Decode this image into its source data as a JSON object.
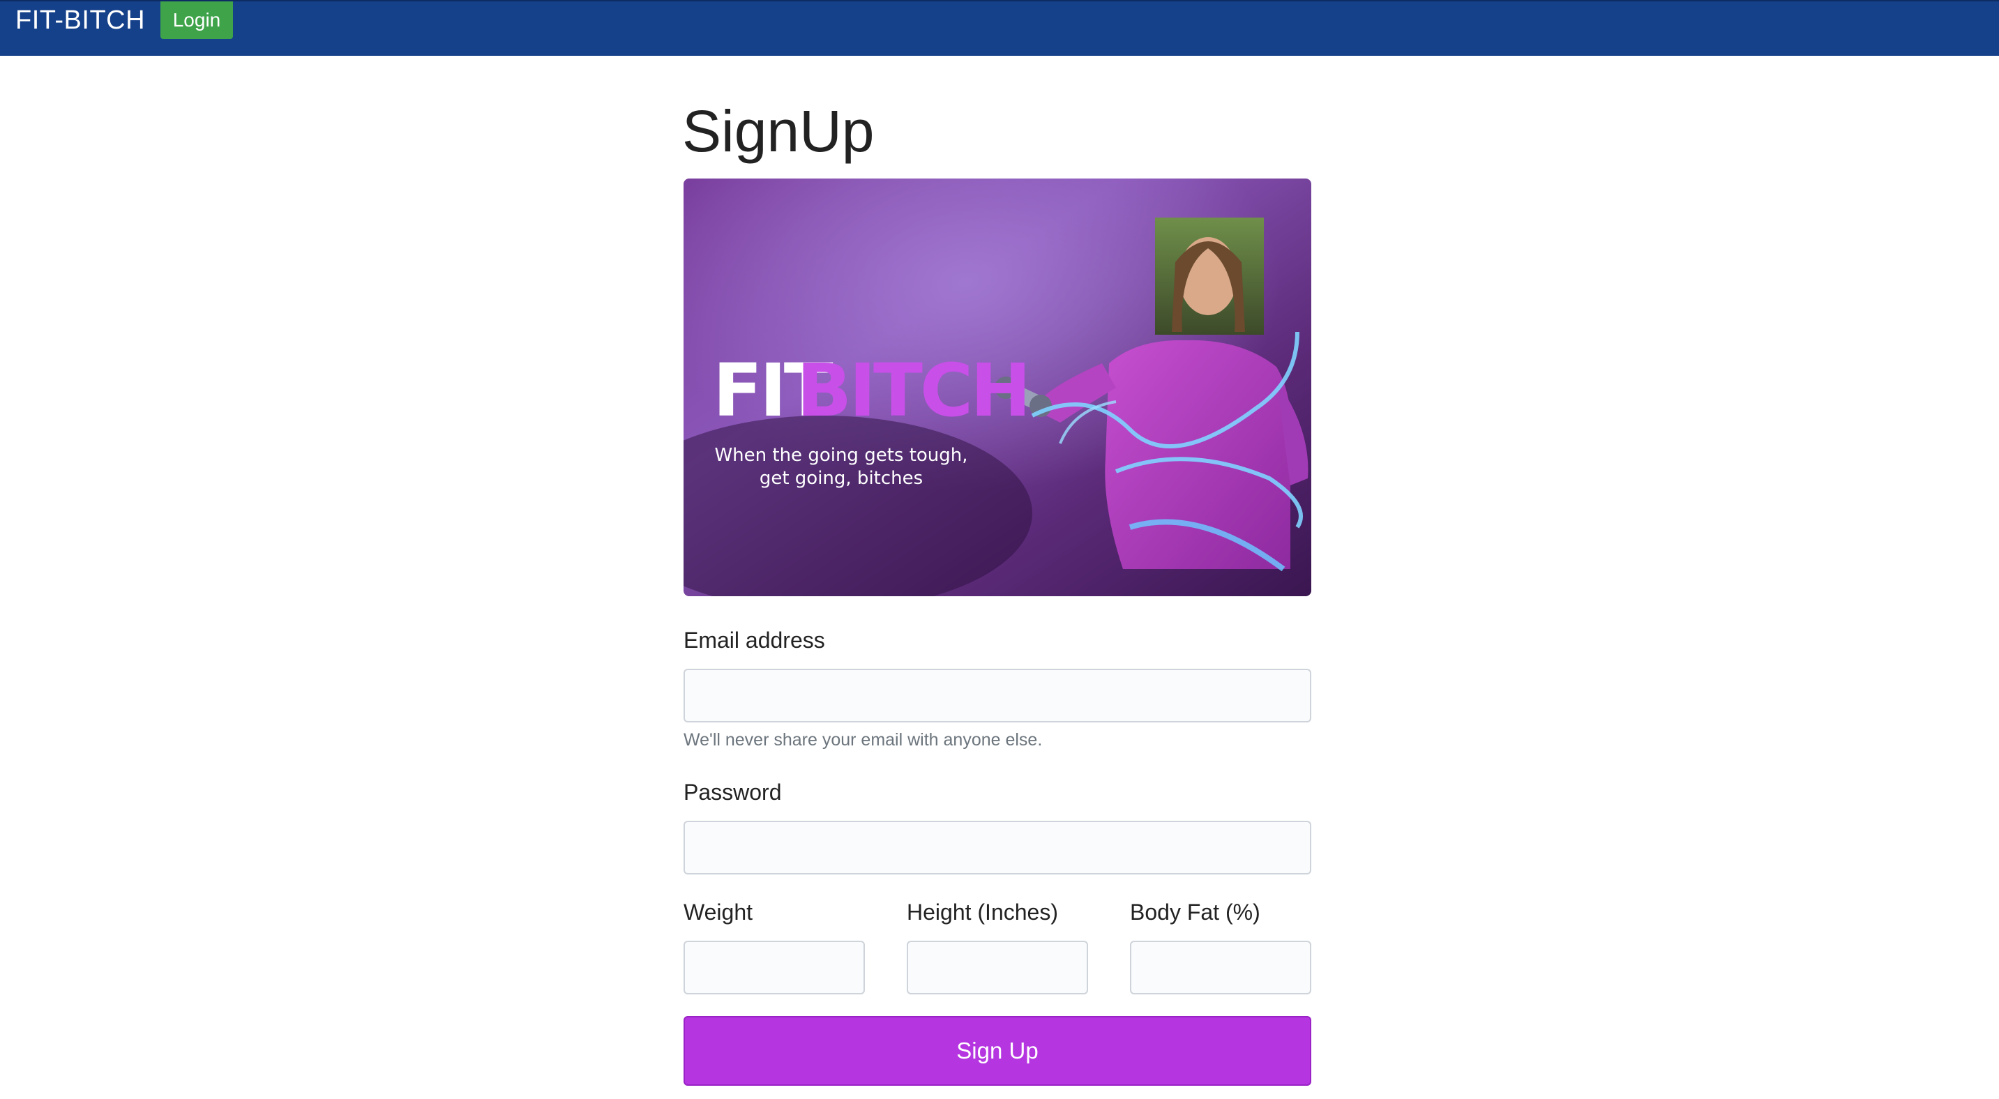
{
  "navbar": {
    "brand": "FIT-BITCH",
    "login_label": "Login"
  },
  "page": {
    "title": "SignUp"
  },
  "hero": {
    "logo_part1": "FIT",
    "logo_part2": "BITCH",
    "tagline_line1": "When the going gets tough,",
    "tagline_line2": "get going, bitches"
  },
  "form": {
    "email_label": "Email address",
    "email_value": "",
    "email_help": "We'll never share your email with anyone else.",
    "password_label": "Password",
    "password_value": "",
    "weight_label": "Weight",
    "weight_value": "",
    "height_label": "Height (Inches)",
    "height_value": "",
    "bodyfat_label": "Body Fat (%)",
    "bodyfat_value": "",
    "submit_label": "Sign Up"
  },
  "colors": {
    "navbar": "#15408a",
    "login_button": "#3fa34a",
    "signup_button": "#b536e0"
  }
}
